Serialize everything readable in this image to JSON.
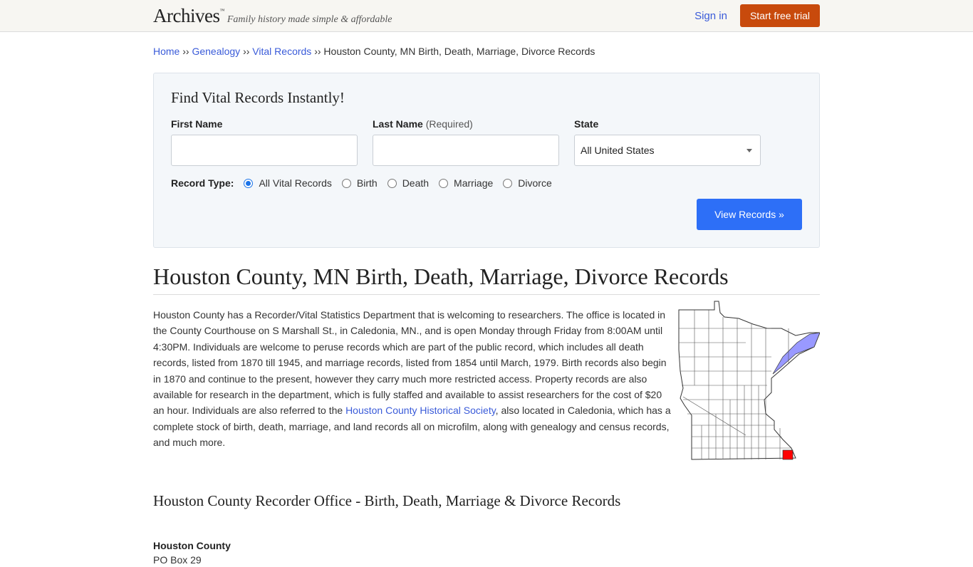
{
  "header": {
    "logo": "Archives",
    "logo_tm": "™",
    "tagline": "Family history made simple & affordable",
    "sign_in": "Sign in",
    "start_trial": "Start free trial"
  },
  "breadcrumb": {
    "items": [
      "Home",
      "Genealogy",
      "Vital Records"
    ],
    "separator": "››",
    "current": "Houston County, MN Birth, Death, Marriage, Divorce Records"
  },
  "search": {
    "title": "Find Vital Records Instantly!",
    "first_name_label": "First Name",
    "first_name_value": "",
    "last_name_label": "Last Name",
    "last_name_required": "(Required)",
    "last_name_value": "",
    "state_label": "State",
    "state_selected": "All United States",
    "record_type_label": "Record Type:",
    "record_types": [
      "All Vital Records",
      "Birth",
      "Death",
      "Marriage",
      "Divorce"
    ],
    "record_type_selected": "All Vital Records",
    "submit": "View Records »"
  },
  "page": {
    "title": "Houston County, MN Birth, Death, Marriage, Divorce Records",
    "intro_part1": "Houston County has a Recorder/Vital Statistics Department that is welcoming to researchers. The office is located in the County Courthouse on S Marshall St., in Caledonia, MN., and is open Monday through Friday from 8:00AM until 4:30PM. Individuals are welcome to peruse records which are part of the public record, which includes all death records, listed from 1870 till 1945, and marriage records, listed from 1854 until March, 1979. Birth records also begin in 1870 and continue to the present, however they carry much more restricted access. Property records are also available for research in the department, which is fully staffed and available to assist researchers for the cost of $20 an hour. Individuals are also referred to the ",
    "intro_link": "Houston County Historical Society",
    "intro_part2": ", also located in Caledonia, which has a complete stock of birth, death, marriage, and land records all on microfilm, along with genealogy and census records, and much more.",
    "map_alt": "Minnesota county map with Houston County highlighted",
    "map_highlight_color": "#ff0000",
    "map_lake_color": "#9999ff",
    "section_title": "Houston County Recorder Office - Birth, Death, Marriage & Divorce Records",
    "office_name": "Houston County",
    "office_address_line1": "PO Box 29"
  },
  "colors": {
    "accent_orange": "#c84a0c",
    "primary_blue": "#2d6ff7",
    "link_blue": "#3a5bd9"
  }
}
